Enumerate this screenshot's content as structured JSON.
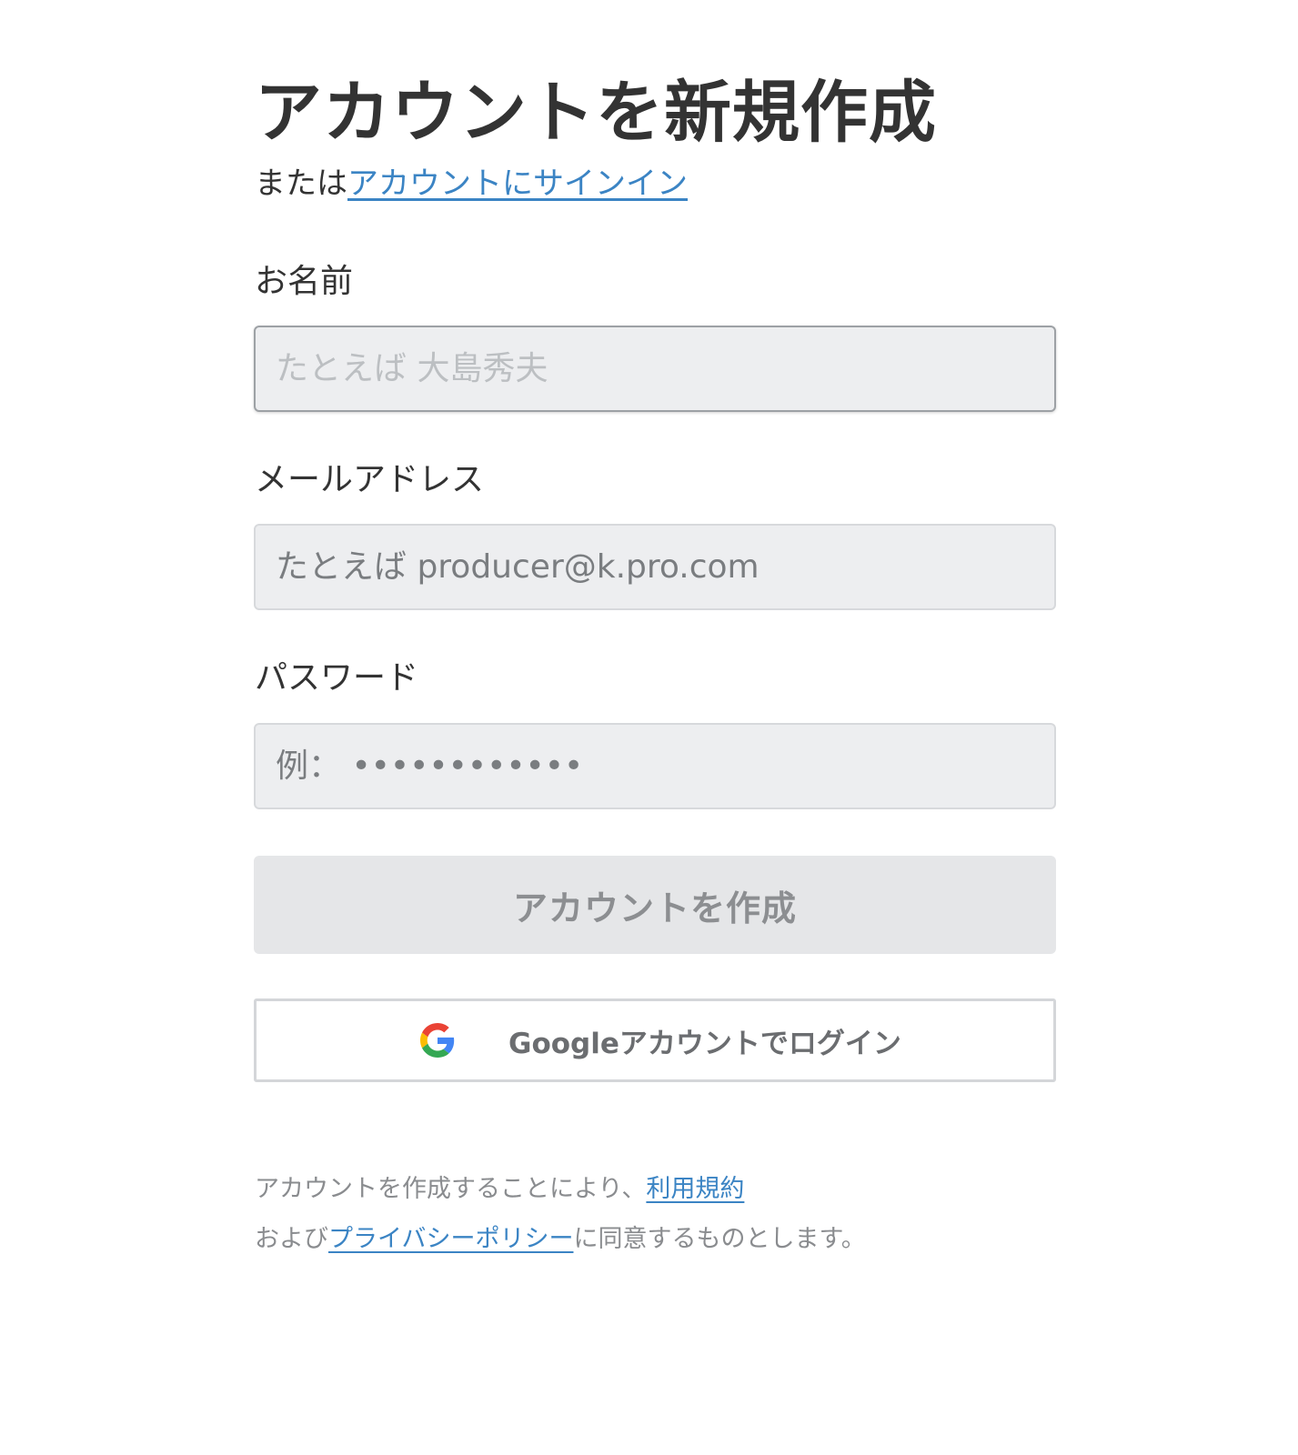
{
  "header": {
    "title": "アカウントを新規作成",
    "subtitle_prefix": "または",
    "signin_link": "アカウントにサインイン"
  },
  "form": {
    "name": {
      "label": "お名前",
      "placeholder": "たとえば 大島秀夫",
      "value": ""
    },
    "email": {
      "label": "メールアドレス",
      "placeholder": "たとえば producer@k.pro.com",
      "value": ""
    },
    "password": {
      "label": "パスワード",
      "placeholder": "例： ••••••••••••",
      "value": ""
    },
    "submit_label": "アカウントを作成",
    "google_label": "Googleアカウントでログイン"
  },
  "legal": {
    "line1_prefix": "アカウントを作成することにより、",
    "terms_link": "利用規約",
    "line2_prefix": "および",
    "privacy_link": "プライバシーポリシー",
    "line2_suffix": "に同意するものとします。"
  },
  "colors": {
    "link": "#3b84c4",
    "text": "#333333",
    "field_bg": "#edeef0",
    "button_disabled_bg": "#e5e6e8"
  },
  "icons": {
    "google": "google-logo-icon"
  }
}
